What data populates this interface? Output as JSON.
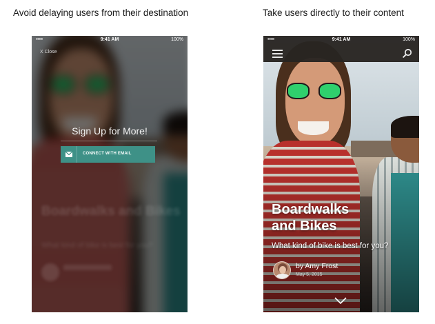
{
  "captions": {
    "left": "Avoid delaying users from their destination",
    "right": "Take users directly to their content"
  },
  "status_bar": {
    "signal": "•••••",
    "time": "9:41 AM",
    "battery": "100%"
  },
  "left_screen": {
    "close_label": "X  Close",
    "signup_title": "Sign Up for More!",
    "connect_button": "CONNECT WITH EMAIL",
    "blurred_title": "Boardwalks and Bikes",
    "blurred_subtitle": "What kind of bike is best for you?",
    "accent_color": "#3e9187"
  },
  "right_screen": {
    "title_line1": "Boardwalks",
    "title_line2": "and Bikes",
    "subtitle": "What kind of bike is best for you?",
    "byline": "by Amy Frost",
    "date": "May 5, 2015",
    "menu_icon": "hamburger-menu-icon",
    "search_icon": "search-icon",
    "scroll_icon": "chevron-down-icon"
  }
}
